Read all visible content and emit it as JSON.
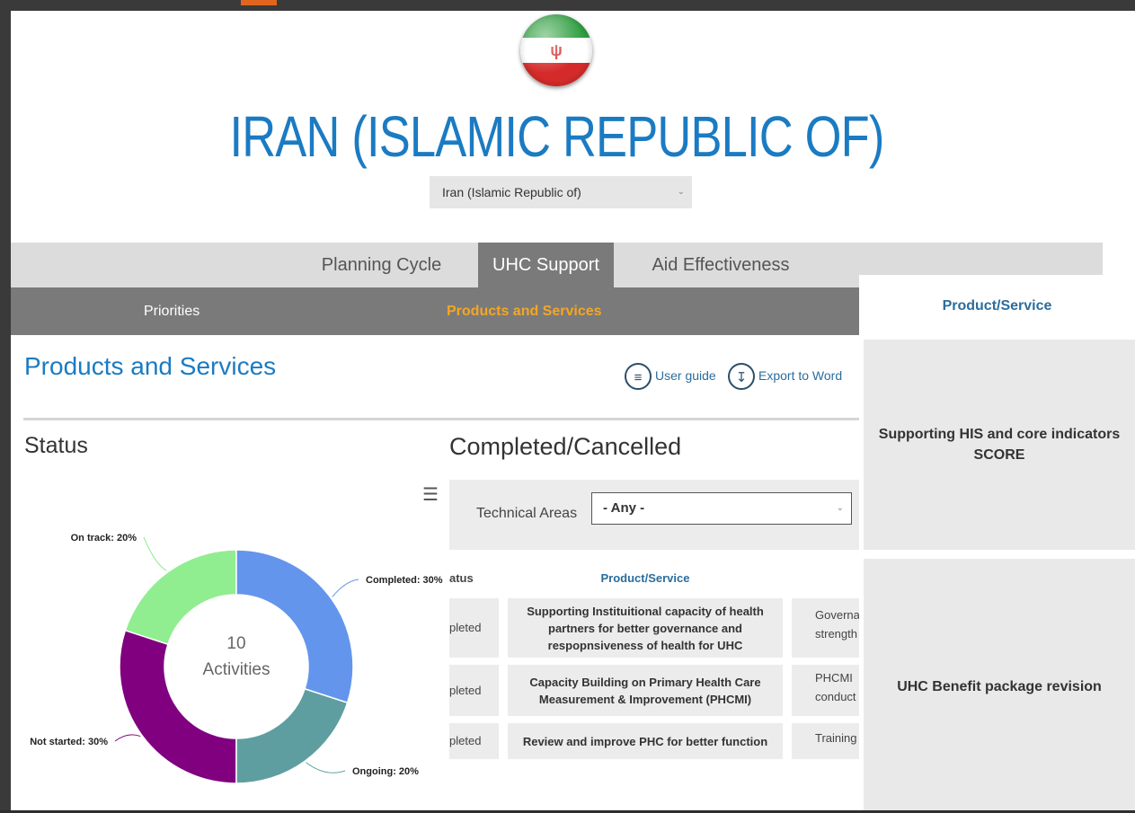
{
  "country": {
    "title": "IRAN (ISLAMIC REPUBLIC OF)",
    "selector_value": "Iran (Islamic Republic of)",
    "flag_icon": "iran-flag-icon"
  },
  "tabs": [
    {
      "label": "Planning Cycle",
      "active": false
    },
    {
      "label": "UHC Support",
      "active": true
    },
    {
      "label": "Aid Effectiveness",
      "active": false
    }
  ],
  "subnav": [
    {
      "label": "Priorities",
      "active": false
    },
    {
      "label": "Products and Services",
      "active": true
    }
  ],
  "page": {
    "title": "Products and Services",
    "user_guide": "User guide",
    "export": "Export to Word"
  },
  "status_panel": {
    "title": "Status",
    "center_count": "10",
    "center_label": "Activities"
  },
  "chart_data": {
    "type": "pie",
    "donut": true,
    "categories": [
      "Completed",
      "Ongoing",
      "Not started",
      "On track"
    ],
    "values": [
      30,
      20,
      30,
      20
    ],
    "labels": [
      "Completed: 30%",
      "Ongoing: 20%",
      "Not started: 30%",
      "On track: 20%"
    ],
    "colors": [
      "#6495ed",
      "#5f9ea0",
      "#800080",
      "#90ee90"
    ]
  },
  "completed_panel": {
    "title": "Completed/Cancelled",
    "filter_label": "Technical Areas",
    "filter_value": "- Any -",
    "col_status": "atus",
    "col_product": "Product/Service",
    "rows": [
      {
        "status": "pleted",
        "product": "Supporting Instituitional capacity of health partners for better governance and respopnsiveness of health for UHC",
        "area_line1": "Governa",
        "area_line2": "strength"
      },
      {
        "status": "pleted",
        "product": "Capacity Building on Primary Health Care Measurement & Improvement (PHCMI)",
        "area_line1": "PHCMI",
        "area_line2": "conduct"
      },
      {
        "status": "pleted",
        "product": "Review and improve PHC for better function",
        "area_line1": "Training",
        "area_line2": ""
      }
    ]
  },
  "right_panel": {
    "header": "Product/Service",
    "cells": [
      {
        "line1": "Supporting HIS and core indicators",
        "line2": "SCORE"
      },
      {
        "line1": "UHC Benefit package revision",
        "line2": ""
      }
    ]
  }
}
